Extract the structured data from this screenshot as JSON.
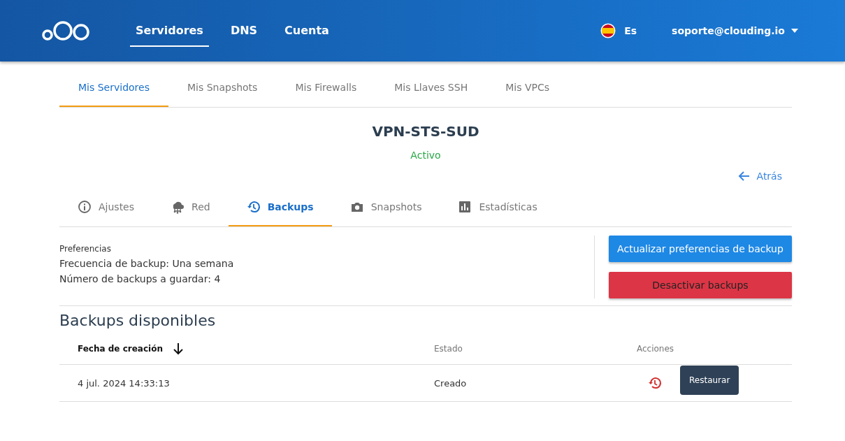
{
  "header": {
    "nav": [
      {
        "label": "Servidores",
        "selected": true
      },
      {
        "label": "DNS",
        "selected": false
      },
      {
        "label": "Cuenta",
        "selected": false
      }
    ],
    "language": "Es",
    "account": "soporte@clouding.io"
  },
  "subtabs": [
    {
      "label": "Mis Servidores",
      "selected": true
    },
    {
      "label": "Mis Snapshots",
      "selected": false
    },
    {
      "label": "Mis Firewalls",
      "selected": false
    },
    {
      "label": "Mis Llaves SSH",
      "selected": false
    },
    {
      "label": "Mis VPCs",
      "selected": false
    }
  ],
  "server": {
    "name": "VPN-STS-SUD",
    "status": "Activo"
  },
  "back_link": "Atrás",
  "tabs": [
    {
      "label": "Ajustes",
      "kind": "info",
      "selected": false
    },
    {
      "label": "Red",
      "kind": "network",
      "selected": false
    },
    {
      "label": "Backups",
      "kind": "history",
      "selected": true
    },
    {
      "label": "Snapshots",
      "kind": "camera",
      "selected": false
    },
    {
      "label": "Estadísticas",
      "kind": "chart",
      "selected": false
    }
  ],
  "preferences": {
    "title": "Preferencias",
    "lines": [
      "Frecuencia de backup: Una semana",
      "Número de backups a guardar: 4"
    ]
  },
  "buttons": [
    {
      "label": "Actualizar preferencias de backup",
      "kind": "primary"
    },
    {
      "label": "Desactivar backups",
      "kind": "danger"
    }
  ],
  "backups": {
    "title": "Backups disponibles",
    "columns": [
      "Fecha de creación",
      "Estado",
      "Acciones"
    ],
    "rows": [
      {
        "date": "4 jul. 2024 14:33:13",
        "status": "Creado",
        "tooltip": "Restaurar"
      }
    ]
  }
}
